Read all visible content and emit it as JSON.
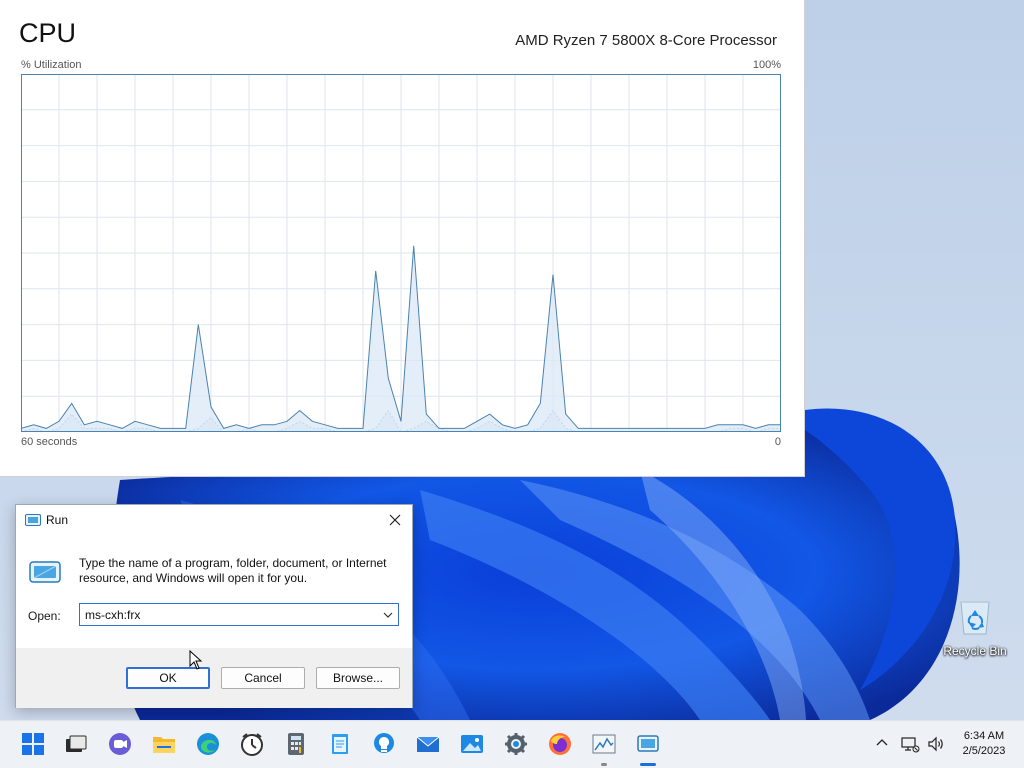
{
  "cpu_panel": {
    "title": "CPU",
    "model": "AMD Ryzen 7 5800X 8-Core Processor",
    "util_label": "% Utilization",
    "util_max": "100%",
    "time_label": "60 seconds",
    "time_min": "0"
  },
  "chart_data": {
    "type": "area",
    "title": "CPU",
    "ylabel": "% Utilization",
    "xlabel": "60 seconds",
    "ylim": [
      0,
      100
    ],
    "xlim": [
      60,
      0
    ],
    "grid": true,
    "x": [
      60,
      59,
      58,
      57,
      56,
      55,
      54,
      53,
      52,
      51,
      50,
      49,
      48,
      47,
      46,
      45,
      44,
      43,
      42,
      41,
      40,
      39,
      38,
      37,
      36,
      35,
      34,
      33,
      32,
      31,
      30,
      29,
      28,
      27,
      26,
      25,
      24,
      23,
      22,
      21,
      20,
      19,
      18,
      17,
      16,
      15,
      14,
      13,
      12,
      11,
      10,
      9,
      8,
      7,
      6,
      5,
      4,
      3,
      2,
      1,
      0
    ],
    "series": [
      {
        "values": [
          1,
          2,
          1,
          3,
          8,
          2,
          3,
          2,
          1,
          3,
          2,
          1,
          1,
          1,
          30,
          7,
          1,
          2,
          1,
          2,
          2,
          3,
          6,
          3,
          2,
          1,
          1,
          1,
          45,
          15,
          3,
          52,
          5,
          1,
          1,
          1,
          3,
          5,
          2,
          1,
          2,
          8,
          44,
          5,
          1,
          1,
          1,
          1,
          1,
          1,
          1,
          1,
          1,
          1,
          1,
          2,
          2,
          2,
          1,
          2,
          2
        ]
      },
      {
        "values": [
          0,
          1,
          0,
          1,
          5,
          1,
          1,
          1,
          0,
          1,
          1,
          0,
          0,
          0,
          1,
          4,
          0,
          0,
          1,
          0,
          0,
          1,
          3,
          1,
          1,
          0,
          0,
          0,
          1,
          6,
          0,
          1,
          3,
          1,
          0,
          0,
          1,
          3,
          1,
          0,
          0,
          1,
          6,
          1,
          0,
          0,
          0,
          0,
          0,
          0,
          0,
          0,
          0,
          0,
          0,
          0,
          1,
          1,
          0,
          1,
          1
        ]
      }
    ],
    "colors": {
      "line": "#4a82b0",
      "fill": "#dbe8f5",
      "line2": "#6f9fc8",
      "grid": "#dde6ef",
      "border": "#4a82b0"
    }
  },
  "run_dialog": {
    "title": "Run",
    "description": "Type the name of a program, folder, document, or Internet resource, and Windows will open it for you.",
    "open_label": "Open:",
    "open_value": "ms-cxh:frx",
    "ok_label": "OK",
    "cancel_label": "Cancel",
    "browse_label": "Browse..."
  },
  "desktop": {
    "recycle_bin_label": "Recycle Bin"
  },
  "taskbar": {
    "icons": [
      "start-icon",
      "task-view-icon",
      "chat-icon",
      "file-explorer-icon",
      "edge-icon",
      "clock-app-icon",
      "calculator-icon",
      "notepad-icon",
      "lightbulb-icon",
      "mail-icon",
      "photos-icon",
      "settings-icon",
      "firefox-icon",
      "task-manager-icon",
      "run-icon"
    ],
    "time": "6:34 AM",
    "date": "2/5/2023"
  }
}
